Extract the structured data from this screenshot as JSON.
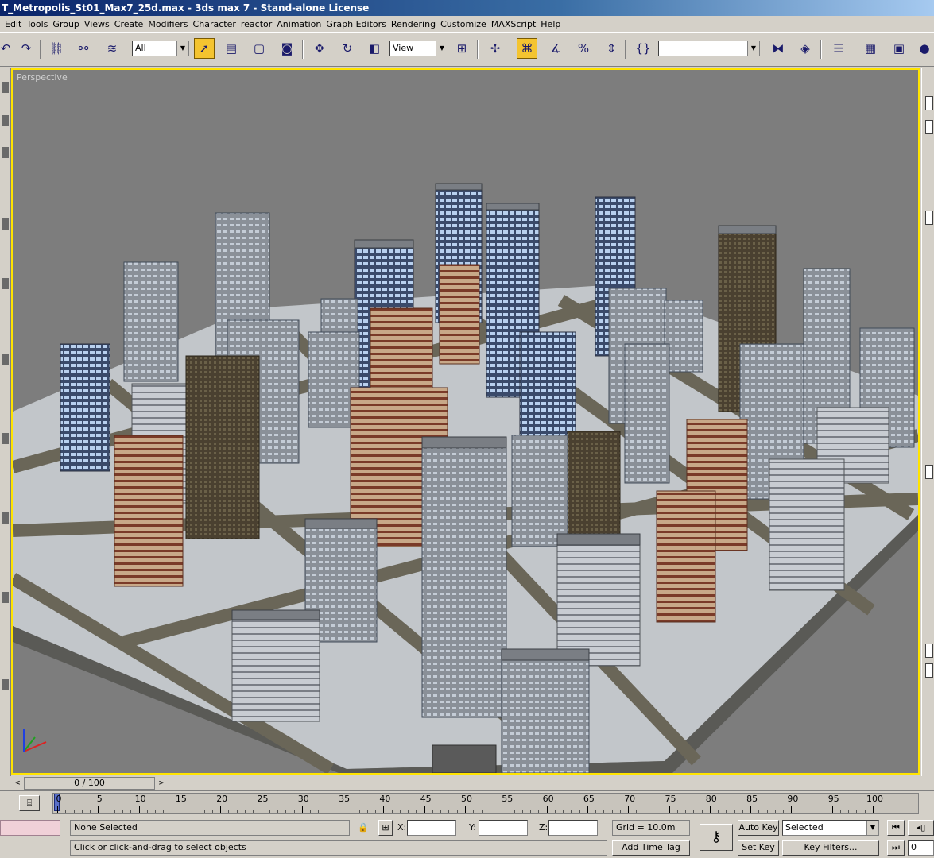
{
  "window": {
    "title": "T_Metropolis_St01_Max7_25d.max - 3ds max 7 - Stand-alone License"
  },
  "menu": [
    "Edit",
    "Tools",
    "Group",
    "Views",
    "Create",
    "Modifiers",
    "Character",
    "reactor",
    "Animation",
    "Graph Editors",
    "Rendering",
    "Customize",
    "MAXScript",
    "Help"
  ],
  "toolbar": {
    "selection_filter": "All",
    "reference_coord": "View",
    "named_selection": ""
  },
  "viewport": {
    "label": "Perspective"
  },
  "timeline": {
    "frame_display": "0 / 100",
    "prev": "<",
    "next": ">"
  },
  "ruler": {
    "ticks": [
      "0",
      "5",
      "10",
      "15",
      "20",
      "25",
      "30",
      "35",
      "40",
      "45",
      "50",
      "55",
      "60",
      "65",
      "70",
      "75",
      "80",
      "85",
      "90",
      "95",
      "100"
    ]
  },
  "status": {
    "selection": "None Selected",
    "prompt": "Click or click-and-drag to select objects",
    "x_label": "X:",
    "y_label": "Y:",
    "z_label": "Z:",
    "x_value": "",
    "y_value": "",
    "z_value": "",
    "grid": "Grid = 10.0m",
    "add_time_tag": "Add Time Tag",
    "auto_key": "Auto Key",
    "set_key": "Set Key",
    "key_mode": "Selected",
    "key_filters": "Key Filters...",
    "current_frame": "0"
  },
  "colors": {
    "title_start": "#0a246a",
    "active_viewport_border": "#ffe400",
    "active_tool": "#f4c430",
    "viewport_bg": "#7d7d7d"
  }
}
